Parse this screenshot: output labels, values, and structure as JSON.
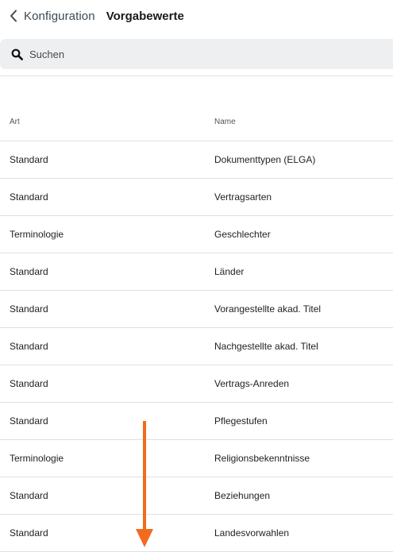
{
  "header": {
    "back_label": "Konfiguration",
    "title": "Vorgabewerte"
  },
  "search": {
    "placeholder": "Suchen"
  },
  "table": {
    "columns": [
      "Art",
      "Name"
    ],
    "rows": [
      {
        "art": "Standard",
        "name": "Dokumenttypen (ELGA)"
      },
      {
        "art": "Standard",
        "name": "Vertragsarten"
      },
      {
        "art": "Terminologie",
        "name": "Geschlechter"
      },
      {
        "art": "Standard",
        "name": "Länder"
      },
      {
        "art": "Standard",
        "name": "Vorangestellte akad. Titel"
      },
      {
        "art": "Standard",
        "name": "Nachgestellte akad. Titel"
      },
      {
        "art": "Standard",
        "name": "Vertrags-Anreden"
      },
      {
        "art": "Standard",
        "name": "Pflegestufen"
      },
      {
        "art": "Terminologie",
        "name": "Religionsbekenntnisse"
      },
      {
        "art": "Standard",
        "name": "Beziehungen"
      },
      {
        "art": "Standard",
        "name": "Landesvorwahlen"
      }
    ]
  },
  "colors": {
    "accent_arrow": "#f26a1b",
    "search_bg": "#eeeff1"
  },
  "icons": {
    "back": "chevron-left-icon",
    "search": "search-icon",
    "annotation": "arrow-down-icon"
  }
}
